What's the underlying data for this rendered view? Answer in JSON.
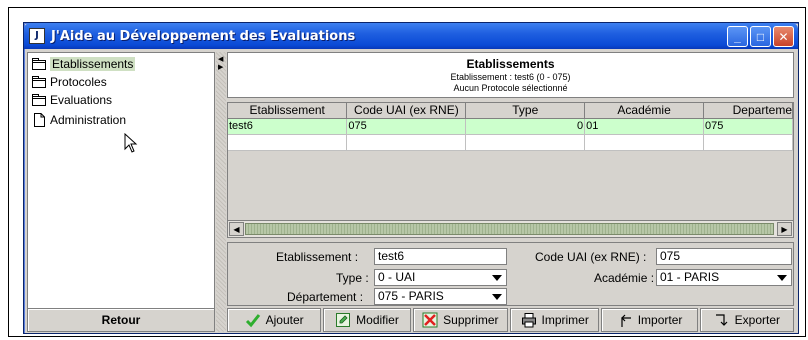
{
  "window": {
    "icon_text": "J",
    "title": "J'Aide au Développement des Evaluations",
    "controls": {
      "minimize": "_",
      "maximize": "□",
      "close": "✕"
    }
  },
  "tree": {
    "items": [
      {
        "label": "Etablissements",
        "icon": "folder-icon",
        "selected": true
      },
      {
        "label": "Protocoles",
        "icon": "folder-icon",
        "selected": false
      },
      {
        "label": "Evaluations",
        "icon": "folder-icon",
        "selected": false
      },
      {
        "label": "Administration",
        "icon": "document-icon",
        "selected": false
      }
    ]
  },
  "retour_label": "Retour",
  "header": {
    "title": "Etablissements",
    "line1": "Etablissement : test6 (0 - 075)",
    "line2": "Aucun Protocole sélectionné"
  },
  "table": {
    "columns": [
      "Etablissement",
      "Code UAI (ex RNE)",
      "Type",
      "Académie",
      "Departeme"
    ],
    "rows": [
      [
        "test6",
        "075",
        "0",
        "01",
        "075"
      ],
      [
        "",
        "",
        "",
        "",
        ""
      ]
    ]
  },
  "form": {
    "etablissement_label": "Etablissement :",
    "etablissement_value": "test6",
    "code_label": "Code UAI (ex RNE) :",
    "code_value": "075",
    "type_label": "Type :",
    "type_value": "0 - UAI",
    "academie_label": "Académie :",
    "academie_value": "01 - PARIS",
    "departement_label": "Département :",
    "departement_value": "075 - PARIS"
  },
  "toolbar": {
    "ajouter": "Ajouter",
    "modifier": "Modifier",
    "supprimer": "Supprimer",
    "imprimer": "Imprimer",
    "importer": "Importer",
    "exporter": "Exporter"
  },
  "colors": {
    "titlebar": "#0a4ad6",
    "window_bg": "#d6d3ce",
    "selected_row": "#ccffcc",
    "selected_tree": "#cfe0c3"
  }
}
